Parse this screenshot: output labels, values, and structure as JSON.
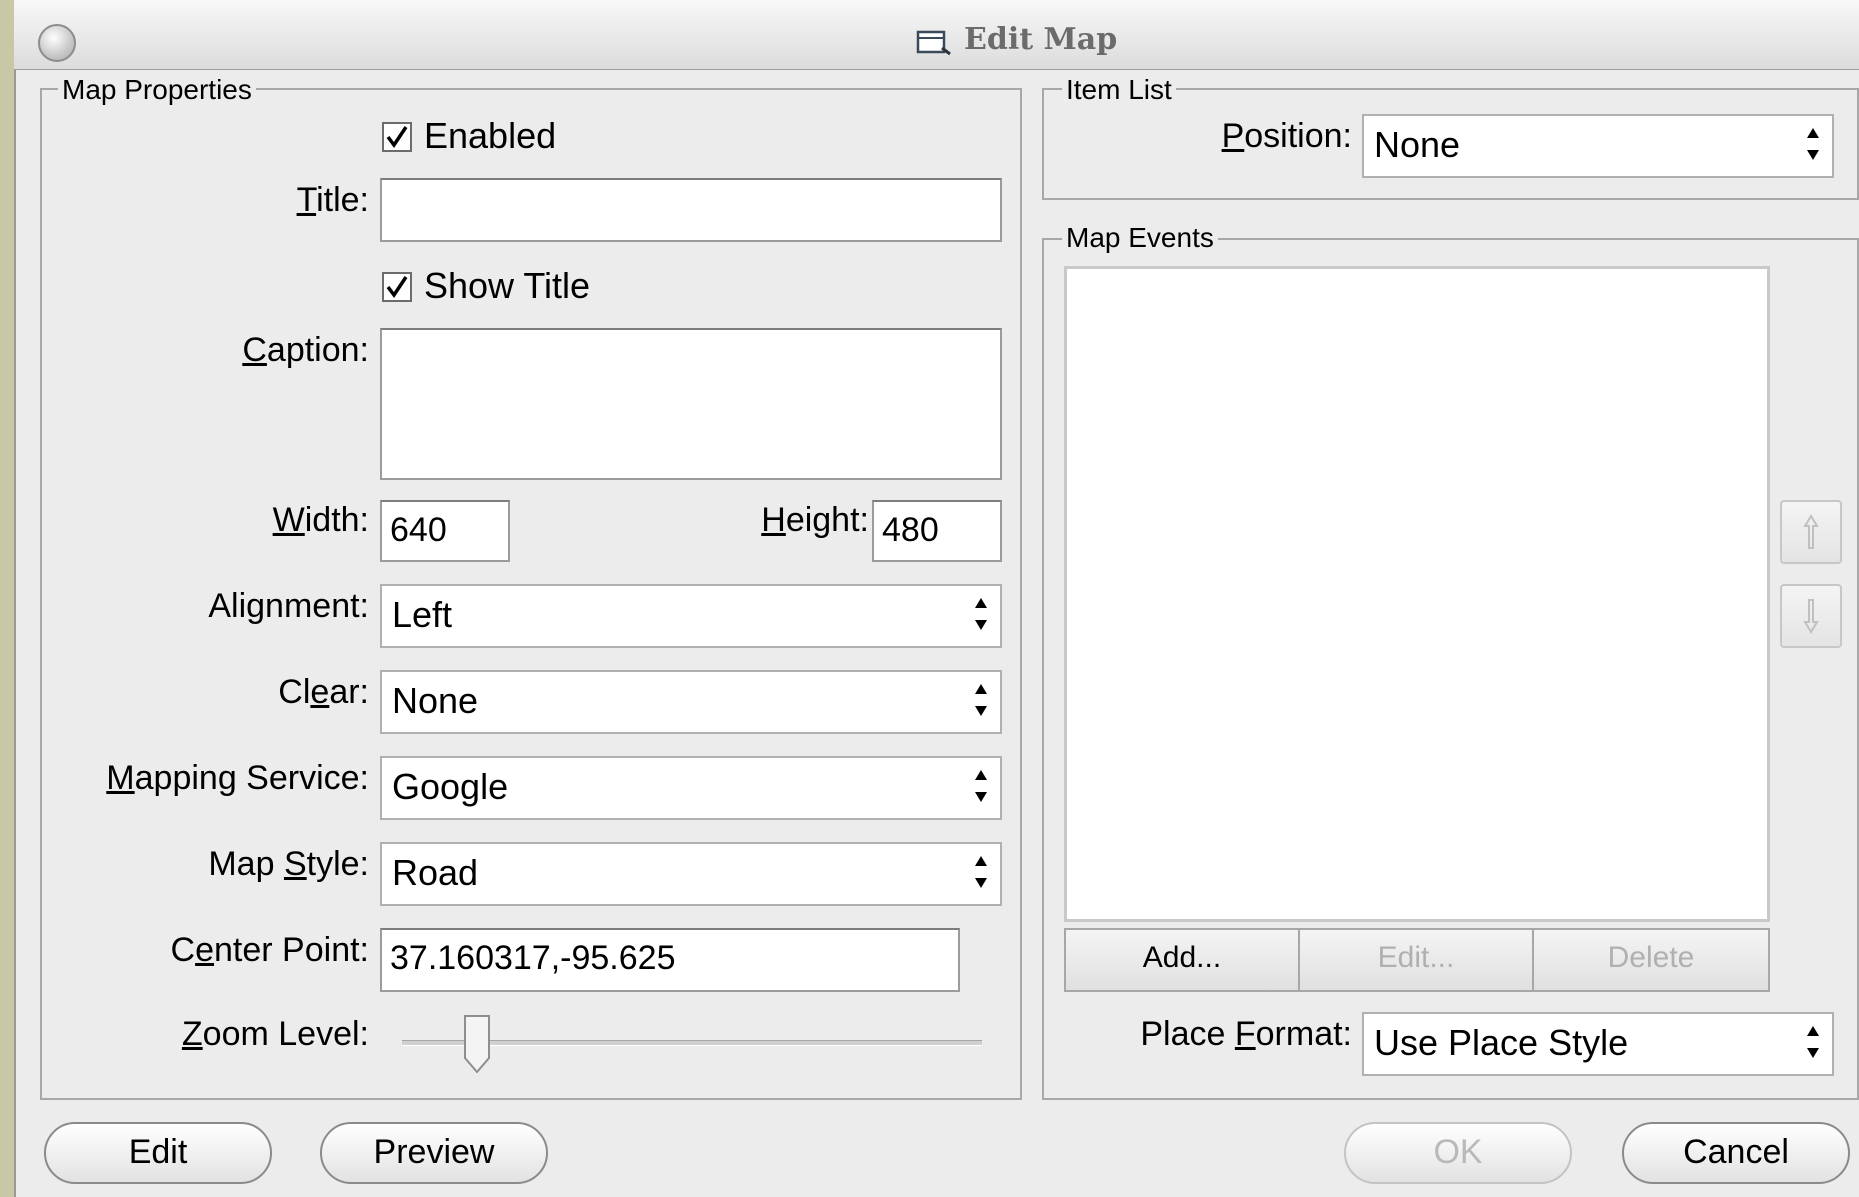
{
  "window": {
    "title": "Edit Map"
  },
  "map_properties": {
    "legend": "Map Properties",
    "enabled": {
      "label": "Enabled",
      "checked": true
    },
    "title": {
      "label": "Title:",
      "value": ""
    },
    "show_title": {
      "label": "Show Title",
      "checked": true
    },
    "caption": {
      "label": "Caption:",
      "value": ""
    },
    "width": {
      "label": "Width:",
      "value": "640"
    },
    "height": {
      "label": "Height:",
      "value": "480"
    },
    "alignment": {
      "label": "Alignment:",
      "value": "Left"
    },
    "clear": {
      "label": "Clear:",
      "value": "None"
    },
    "mapping_service": {
      "label": "Mapping Service:",
      "value": "Google"
    },
    "map_style": {
      "label": "Map Style:",
      "value": "Road"
    },
    "center_point": {
      "label": "Center Point:",
      "value": "37.160317,-95.625"
    },
    "zoom_level": {
      "label": "Zoom Level:",
      "fraction": 0.13
    }
  },
  "item_list": {
    "legend": "Item List",
    "position": {
      "label": "Position:",
      "value": "None"
    }
  },
  "map_events": {
    "legend": "Map Events",
    "add_label": "Add...",
    "edit_label": "Edit...",
    "delete_label": "Delete",
    "place_format": {
      "label": "Place Format:",
      "value": "Use Place Style"
    }
  },
  "footer": {
    "edit_label": "Edit",
    "preview_label": "Preview",
    "ok_label": "OK",
    "cancel_label": "Cancel"
  },
  "colors": {
    "window_bg": "#ececec",
    "desktop_bg": "#c9c8a6",
    "disabled_text": "#b9b9b9"
  }
}
